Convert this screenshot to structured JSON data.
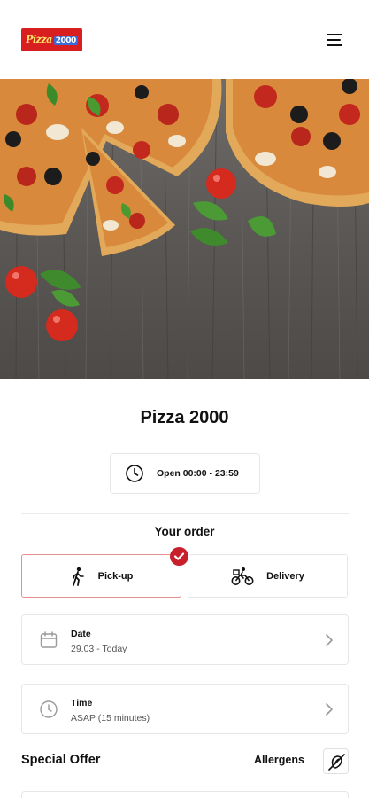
{
  "header": {
    "logo_text": "Pizza",
    "logo_num": "2000",
    "menu_icon": "hamburger-menu-icon"
  },
  "hero": {
    "image": "pizza-on-wooden-table"
  },
  "restaurant": {
    "name": "Pizza 2000",
    "hours": "Open 00:00 - 23:59",
    "hours_icon": "clock-icon"
  },
  "order": {
    "title": "Your order",
    "pickup_label": "Pick-up",
    "pickup_icon": "walking-person-icon",
    "delivery_label": "Delivery",
    "delivery_icon": "bicycle-delivery-icon",
    "selected": "pickup"
  },
  "date": {
    "label": "Date",
    "value": "29.03 - Today",
    "icon": "calendar-icon"
  },
  "time": {
    "label": "Time",
    "value": "ASAP (15 minutes)",
    "icon": "clock-icon"
  },
  "special_offer": {
    "title": "Special Offer"
  },
  "allergens": {
    "label": "Allergens",
    "icon": "allergen-filter-icon"
  },
  "colors": {
    "accent": "#c91f2b",
    "selected_border": "#ea8f8f",
    "border": "#e7e7e7"
  }
}
